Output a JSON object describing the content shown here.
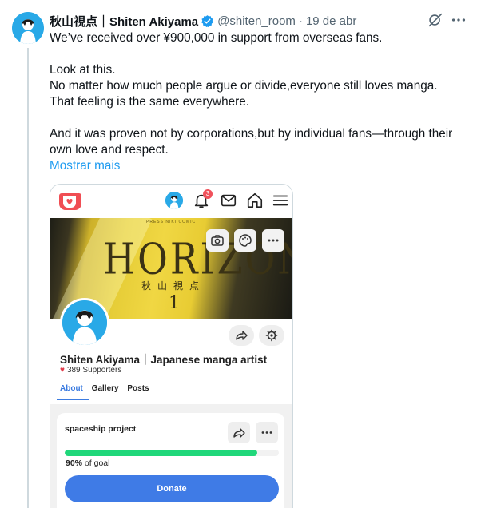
{
  "tweet": {
    "author_name": "秋山視点｜Shiten Akiyama",
    "handle": "@shiten_room",
    "separator": "·",
    "date": "19 de abr",
    "lines": [
      "We’ve received over ¥900,000 in support from overseas fans.",
      "",
      "Look at this.",
      "No matter how much people argue or divide,everyone still loves manga.",
      "That feeling is the same everywhere.",
      "",
      "And it was proven not by corporations,but by individual fans—through their",
      "own love and respect."
    ],
    "show_more": "Mostrar mais",
    "icons": {
      "verified": "verified-badge-icon",
      "grok": "grok-icon",
      "more": "more-icon"
    },
    "colors": {
      "link": "#1d9bf0",
      "verified": "#1d9bf0",
      "muted": "#536471"
    }
  },
  "media": {
    "app_bar": {
      "notification_count": "3",
      "icons": [
        "app-logo-icon",
        "avatar",
        "bell-icon",
        "mail-icon",
        "home-icon",
        "menu-icon"
      ]
    },
    "banner": {
      "small_text": "PRESS NIKI COMIC",
      "title": "HORIZON",
      "kanji": "秋山視点",
      "volume": "1"
    },
    "profile": {
      "name": "Shiten Akiyama｜Japanese manga artist",
      "supporters": "389 Supporters",
      "tabs": [
        "About",
        "Gallery",
        "Posts"
      ],
      "active_tab": "About"
    },
    "goal": {
      "title": "spaceship project",
      "percent": 90,
      "percent_label": "90%",
      "percent_suffix": " of goal",
      "donate_label": "Donate"
    },
    "colors": {
      "accent": "#3f7be6",
      "progress": "#20d77a",
      "heart": "#e23b4a",
      "badge": "#f0515b"
    }
  }
}
